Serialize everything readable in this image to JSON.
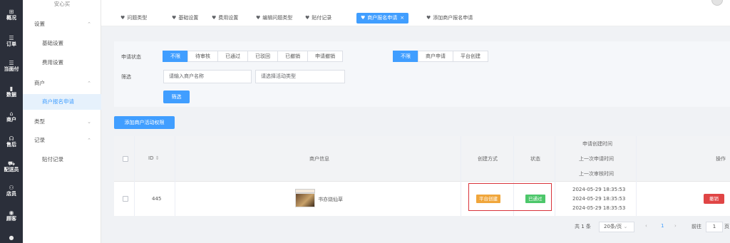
{
  "rail": [
    {
      "icon": "⊞",
      "label": "概况",
      "icon_name": "dashboard-icon"
    },
    {
      "icon": "☰",
      "label": "订单",
      "icon_name": "order-icon"
    },
    {
      "icon": "☰",
      "label": "当面付",
      "icon_name": "pay-icon"
    },
    {
      "icon": "▮",
      "label": "数据",
      "icon_name": "chart-icon"
    },
    {
      "icon": "⌂",
      "label": "商户",
      "icon_name": "shop-icon"
    },
    {
      "icon": "☊",
      "label": "售后",
      "icon_name": "headset-icon"
    },
    {
      "icon": "⛟",
      "label": "配送员",
      "icon_name": "delivery-icon"
    },
    {
      "icon": "⚇",
      "label": "店员",
      "icon_name": "staff-icon"
    },
    {
      "icon": "◉",
      "label": "顾客",
      "icon_name": "customer-icon"
    },
    {
      "icon": "●",
      "label": "",
      "icon_name": "more-icon"
    }
  ],
  "menu": {
    "top_faded": "安心买",
    "settings_group": "设置",
    "basic_settings": "基础设置",
    "fee_settings": "费用设置",
    "merchant_group": "商户",
    "merchant_signup": "商户报名申请",
    "type_group": "类型",
    "records_group": "记录",
    "sticker_records": "贴付记录"
  },
  "tabs": [
    {
      "label": "问题类型"
    },
    {
      "label": "基础设置"
    },
    {
      "label": "费用设置"
    },
    {
      "label": "编辑问题类型"
    },
    {
      "label": "贴付记录"
    },
    {
      "label": "商户报名申请",
      "active": true,
      "close": "×"
    },
    {
      "label": "添加商户报名申请"
    }
  ],
  "filter": {
    "status_label": "申请状态",
    "status_options": [
      "不限",
      "待审核",
      "已通过",
      "已驳回",
      "已撤销",
      "申请撤销"
    ],
    "status_selected": "不限",
    "source_options": [
      "不限",
      "商户申请",
      "平台创建"
    ],
    "source_selected": "不限",
    "search_label": "筛选",
    "merchant_placeholder": "请输入商户名称",
    "activity_placeholder": "请选择活动类型",
    "filter_button": "筛选"
  },
  "add_button": "添加商户活动权限",
  "table": {
    "headers": {
      "id": "ID",
      "sort": "⇕",
      "merchant_info": "商户信息",
      "create_method": "创建方式",
      "status": "状态",
      "time1": "申请创建时间",
      "time2": "上一次申请时间",
      "time3": "上一次审核时间",
      "action": "操作"
    },
    "rows": [
      {
        "id": "445",
        "merchant_name": "书亦烧仙草",
        "create_method": "平台创建",
        "status": "已通过",
        "created_at": "2024-05-29 18:35:53",
        "last_applied_at": "2024-05-29 18:35:53",
        "last_reviewed_at": "2024-05-29 18:35:53",
        "action": "撤销"
      }
    ]
  },
  "pagination": {
    "total": "共 1 条",
    "page_size": "20条/页",
    "prev": "‹",
    "page": "1",
    "next": "›",
    "goto_label": "前往",
    "goto_value": "1",
    "page_suffix": "页"
  },
  "colors": {
    "primary": "#409eff",
    "sidebar": "#2b2f3a",
    "tag_platform": "#f0a63b",
    "tag_passed": "#4cc76a",
    "danger": "#e04545",
    "highlight_box": "#d9333a"
  }
}
